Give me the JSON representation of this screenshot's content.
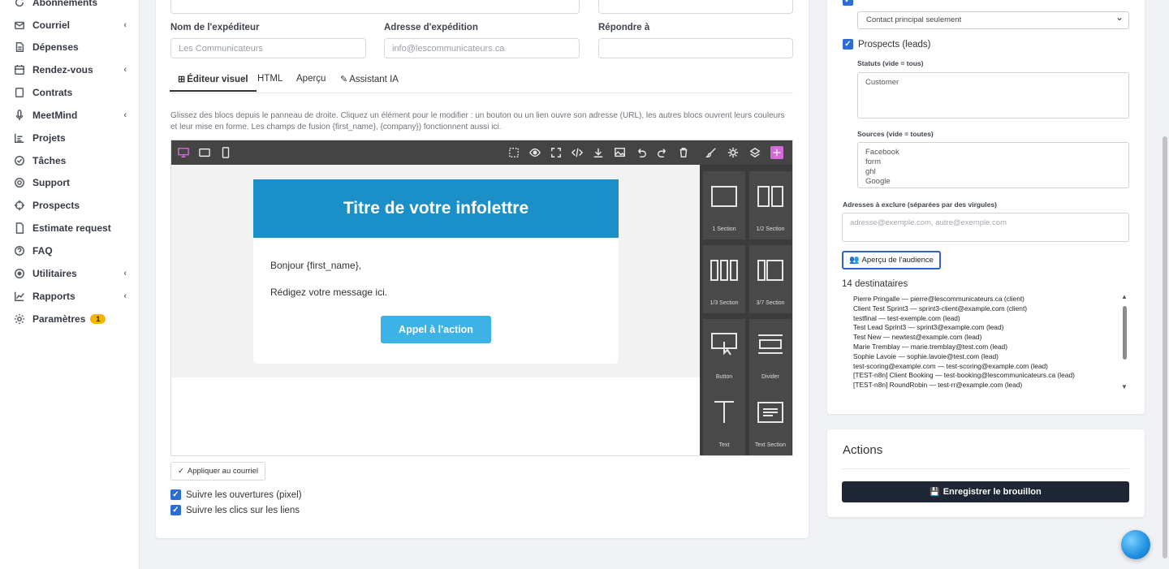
{
  "sidebar": {
    "items": [
      {
        "label": "Abonnements",
        "icon": "refresh-icon",
        "chevron": false
      },
      {
        "label": "Courriel",
        "icon": "mail-icon",
        "chevron": true
      },
      {
        "label": "Dépenses",
        "icon": "receipt-icon",
        "chevron": false
      },
      {
        "label": "Rendez-vous",
        "icon": "calendar-icon",
        "chevron": true
      },
      {
        "label": "Contrats",
        "icon": "contract-icon",
        "chevron": false
      },
      {
        "label": "MeetMind",
        "icon": "mic-icon",
        "chevron": true
      },
      {
        "label": "Projets",
        "icon": "chart-icon",
        "chevron": false
      },
      {
        "label": "Tâches",
        "icon": "check-circle-icon",
        "chevron": false
      },
      {
        "label": "Support",
        "icon": "lifebuoy-icon",
        "chevron": false
      },
      {
        "label": "Prospects",
        "icon": "crosshair-icon",
        "chevron": false
      },
      {
        "label": "Estimate request",
        "icon": "document-icon",
        "chevron": false
      },
      {
        "label": "FAQ",
        "icon": "question-icon",
        "chevron": false
      },
      {
        "label": "Utilitaires",
        "icon": "dot-circle-icon",
        "chevron": true
      },
      {
        "label": "Rapports",
        "icon": "line-chart-icon",
        "chevron": true
      },
      {
        "label": "Paramètres",
        "icon": "gear-icon",
        "chevron": false,
        "badge": "1"
      }
    ]
  },
  "form": {
    "sender_name_label": "Nom de l'expéditeur",
    "sender_name_placeholder": "Les Communicateurs",
    "sender_address_label": "Adresse d'expédition",
    "sender_address_placeholder": "info@lescommunicateurs.ca",
    "reply_to_label": "Répondre à",
    "reply_to_value": ""
  },
  "tabs": [
    {
      "label": "Éditeur visuel",
      "active": true
    },
    {
      "label": "HTML",
      "active": false
    },
    {
      "label": "Aperçu",
      "active": false
    },
    {
      "label": "Assistant IA",
      "active": false
    }
  ],
  "help_text": "Glissez des blocs depuis le panneau de droite. Cliquez un élément pour le modifier : un bouton ou un lien ouvre son adresse (URL), les autres blocs ouvrent leurs couleurs et leur mise en forme. Les champs de fusion {first_name}, {company}) fonctionnent aussi ici.",
  "newsletter": {
    "title": "Titre de votre infolettre",
    "greeting": "Bonjour {first_name},",
    "message": "Rédigez votre message ici.",
    "cta": "Appel à l'action",
    "header_color": "#1a8fc8",
    "cta_color": "#3cb2e6"
  },
  "blocks": [
    {
      "label": "1 Section"
    },
    {
      "label": "1/2 Section"
    },
    {
      "label": "1/3 Section"
    },
    {
      "label": "3/7 Section"
    },
    {
      "label": "Button"
    },
    {
      "label": "Divider"
    },
    {
      "label": "Text"
    },
    {
      "label": "Text Section"
    }
  ],
  "apply_button": "Appliquer au courriel",
  "tracking": {
    "opens": "Suivre les ouvertures (pixel)",
    "clicks": "Suivre les clics sur les liens"
  },
  "audience": {
    "contact_select": "Contact principal seulement",
    "prospects_label": "Prospects (leads)",
    "status_label": "Statuts (vide = tous)",
    "status_values": [
      "Customer"
    ],
    "sources_label": "Sources (vide = toutes)",
    "sources_values": [
      "Facebook",
      "form",
      "ghl",
      "Google"
    ],
    "exclude_label": "Adresses à exclure (séparées par des virgules)",
    "exclude_placeholder": "adresse@exemple.com, autre@exemple.com",
    "preview_button": "Aperçu de l'audience",
    "count_text": "14 destinataires",
    "recipients": [
      "Pierre Pringalle — pierre@lescommunicateurs.ca (client)",
      "Client Test Sprint3 — sprint3-client@example.com (client)",
      "testfinal — test-exemple.com (lead)",
      "Test Lead Sprint3 — sprint3@example.com (lead)",
      "Test New — newtest@example.com (lead)",
      "Marie Tremblay — marie.tremblay@test.com (lead)",
      "Sophie Lavoie — sophie.lavoie@test.com (lead)",
      "test-scoring@example.com — test-scoring@example.com (lead)",
      "[TEST-n8n] Client Booking — test-booking@lescommunicateurs.ca (lead)",
      "[TEST-n8n] RoundRobin — test-rr@example.com (lead)"
    ]
  },
  "actions": {
    "title": "Actions",
    "save_button": "Enregistrer le brouillon"
  }
}
